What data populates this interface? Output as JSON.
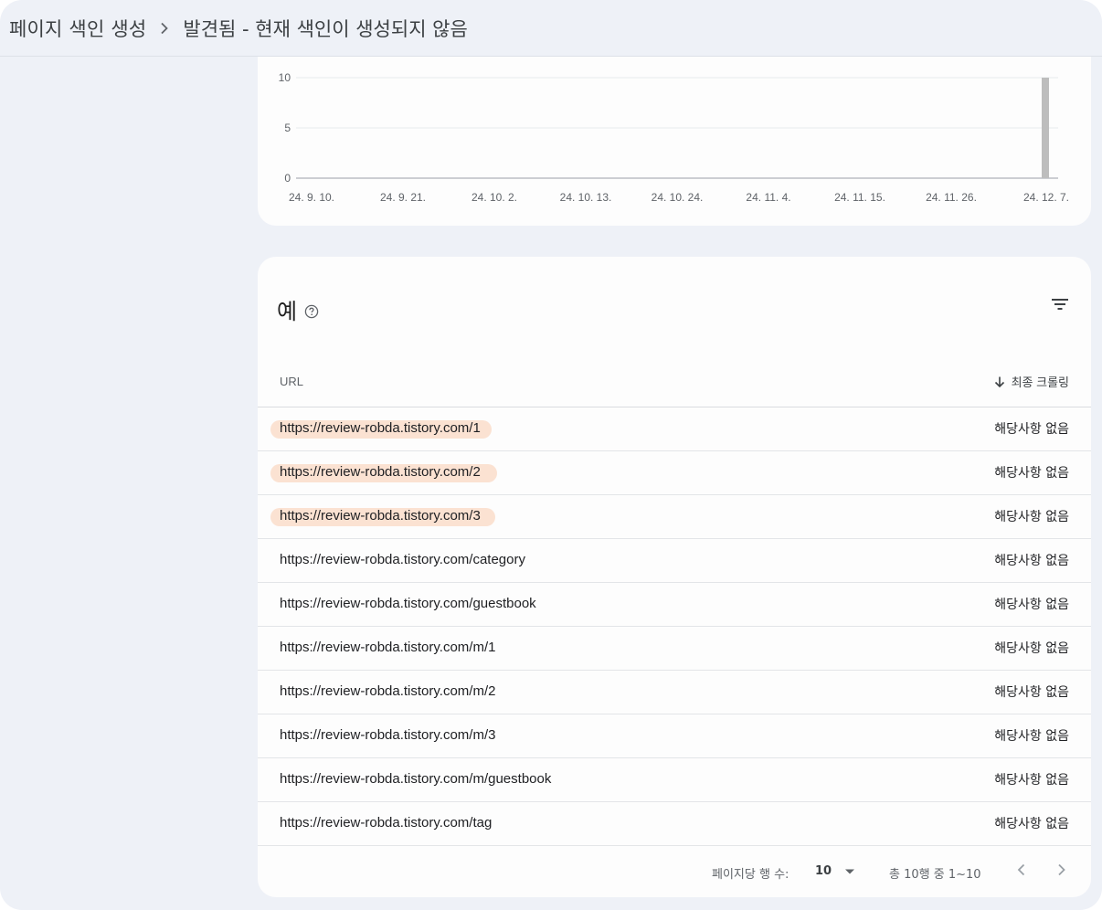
{
  "breadcrumb": {
    "parent": "페이지 색인 생성",
    "current": "발견됨 - 현재 색인이 생성되지 않음"
  },
  "chart_data": {
    "type": "bar",
    "x_tick_labels": [
      "24. 9. 10.",
      "24. 9. 21.",
      "24. 10. 2.",
      "24. 10. 13.",
      "24. 10. 24.",
      "24. 11. 4.",
      "24. 11. 15.",
      "24. 11. 26.",
      "24. 12. 7."
    ],
    "y_tick_labels": [
      "10",
      "5",
      "0"
    ],
    "ylim": [
      0,
      10
    ],
    "grid": true,
    "series": [
      {
        "values": [
          {
            "x": "24. 12. 7.",
            "y": 10
          }
        ],
        "color": "#bdbdbd"
      }
    ]
  },
  "examples": {
    "title": "예",
    "col_url": "URL",
    "col_crawl": "최종 크롤링",
    "highlight_color": "#fbe2d2",
    "rows": [
      {
        "url": "https://review-robda.tistory.com/1",
        "status": "해당사항 없음",
        "highlighted": true
      },
      {
        "url": "https://review-robda.tistory.com/2",
        "status": "해당사항 없음",
        "highlighted": true
      },
      {
        "url": "https://review-robda.tistory.com/3",
        "status": "해당사항 없음",
        "highlighted": true
      },
      {
        "url": "https://review-robda.tistory.com/category",
        "status": "해당사항 없음",
        "highlighted": false
      },
      {
        "url": "https://review-robda.tistory.com/guestbook",
        "status": "해당사항 없음",
        "highlighted": false
      },
      {
        "url": "https://review-robda.tistory.com/m/1",
        "status": "해당사항 없음",
        "highlighted": false
      },
      {
        "url": "https://review-robda.tistory.com/m/2",
        "status": "해당사항 없음",
        "highlighted": false
      },
      {
        "url": "https://review-robda.tistory.com/m/3",
        "status": "해당사항 없음",
        "highlighted": false
      },
      {
        "url": "https://review-robda.tistory.com/m/guestbook",
        "status": "해당사항 없음",
        "highlighted": false
      },
      {
        "url": "https://review-robda.tistory.com/tag",
        "status": "해당사항 없음",
        "highlighted": false
      }
    ]
  },
  "pagination": {
    "rows_per_page_label": "페이지당 행 수:",
    "rows_per_page": "10",
    "range": "총 10행 중 1~10"
  },
  "icons": {
    "breadcrumb_sep": "chevron-right-icon",
    "help": "help-circle-icon",
    "filter": "filter-icon",
    "sort": "arrow-down-icon",
    "dropdown": "caret-down-icon",
    "prev": "chevron-left-icon",
    "next": "chevron-right-icon"
  }
}
